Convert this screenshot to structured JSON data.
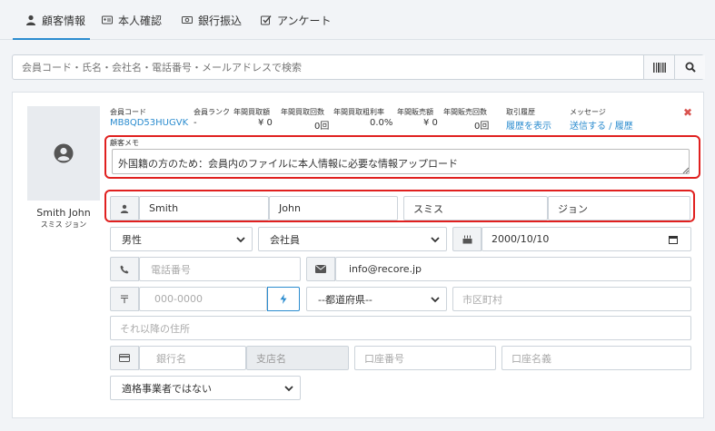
{
  "tabs": [
    {
      "label": "顧客情報",
      "icon": "user-icon",
      "active": true
    },
    {
      "label": "本人確認",
      "icon": "id-card-icon",
      "active": false
    },
    {
      "label": "銀行振込",
      "icon": "money-icon",
      "active": false
    },
    {
      "label": "アンケート",
      "icon": "checkbox-icon",
      "active": false
    }
  ],
  "search": {
    "placeholder": "会員コード・氏名・会社名・電話番号・メールアドレスで検索"
  },
  "customer": {
    "name_en": "Smith John",
    "name_kana": "スミス ジョン",
    "stats": [
      {
        "label": "会員コード",
        "value": "MB8QD53HUGVK",
        "link": true
      },
      {
        "label": "会員ランク",
        "value": "-"
      },
      {
        "label": "年間買取額",
        "value": "¥ 0"
      },
      {
        "label": "年間買取回数",
        "value": "0回"
      },
      {
        "label": "年間買取粗利率",
        "value": "0.0%"
      },
      {
        "label": "年間販売額",
        "value": "¥ 0"
      },
      {
        "label": "年間販売回数",
        "value": "0回"
      },
      {
        "label": "取引履歴",
        "value": "履歴を表示",
        "link": true
      },
      {
        "label": "メッセージ",
        "value": "送信する / 履歴",
        "link": true
      }
    ],
    "memo_label": "顧客メモ",
    "memo": "外国籍の方のため：会員内のファイルに本人情報に必要な情報アップロード",
    "last_name": "Smith",
    "first_name": "John",
    "last_name_kana": "スミス",
    "first_name_kana": "ジョン",
    "gender": "男性",
    "type": "会社員",
    "birthday": "2000/10/10",
    "phone_placeholder": "電話番号",
    "email": "info@recore.jp",
    "zip_placeholder": "000-0000",
    "prefecture": "--都道府県--",
    "city_placeholder": "市区町村",
    "address_placeholder": "それ以降の住所",
    "bank_placeholder": "銀行名",
    "branch_placeholder": "支店名",
    "account_number_placeholder": "口座番号",
    "account_name_placeholder": "口座名義",
    "invoice_status": "適格事業者ではない"
  },
  "colors": {
    "accent": "#2b8ccf",
    "highlight": "#e0201f",
    "close": "#d9534f"
  }
}
